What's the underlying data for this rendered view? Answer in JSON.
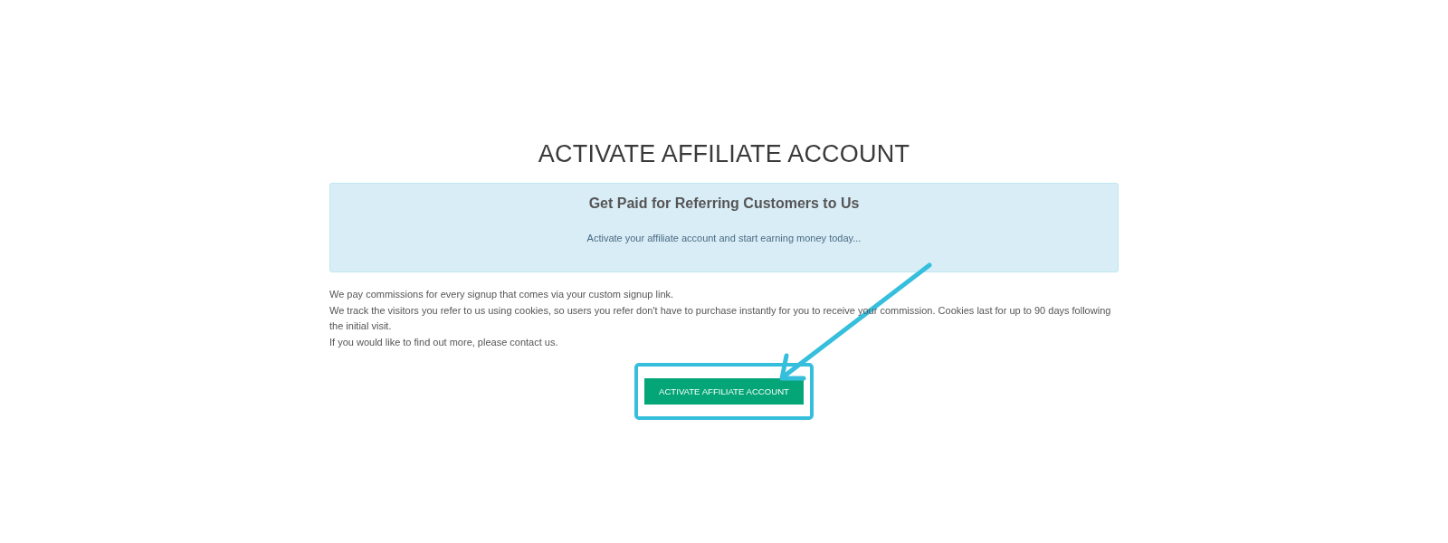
{
  "page": {
    "title": "ACTIVATE AFFILIATE ACCOUNT"
  },
  "banner": {
    "heading": "Get Paid for Referring Customers to Us",
    "text": "Activate your affiliate account and start earning money today..."
  },
  "description": [
    "We pay commissions for every signup that comes via your custom signup link.",
    "We track the visitors you refer to us using cookies, so users you refer don't have to purchase instantly for you to receive your commission. Cookies last for up to 90 days following the initial visit.",
    "If you would like to find out more, please contact us."
  ],
  "button": {
    "label": "ACTIVATE AFFILIATE ACCOUNT"
  }
}
